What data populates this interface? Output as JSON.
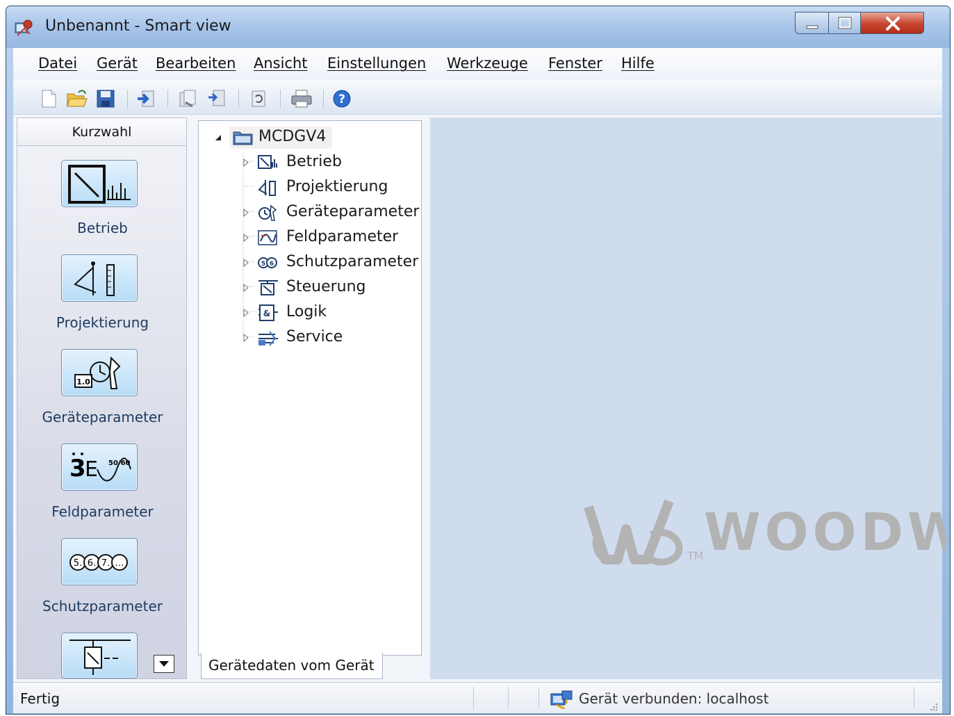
{
  "window": {
    "title": "Unbenannt  - Smart view"
  },
  "menu": {
    "items": [
      "Datei",
      "Gerät",
      "Bearbeiten",
      "Ansicht",
      "Einstellungen",
      "Werkzeuge",
      "Fenster",
      "Hilfe"
    ]
  },
  "toolbar": {
    "icons": [
      "new-document-icon",
      "open-folder-icon",
      "save-icon",
      "transfer-icon",
      "receive-icon",
      "send-icon",
      "refresh-icon",
      "print-icon",
      "help-icon"
    ]
  },
  "quick_access": {
    "header": "Kurzwahl",
    "items": [
      {
        "label": "Betrieb",
        "icon": "operation-meter-icon"
      },
      {
        "label": "Projektierung",
        "icon": "planning-icon"
      },
      {
        "label": "Geräteparameter",
        "icon": "device-parameter-icon"
      },
      {
        "label": "Feldparameter",
        "icon": "field-parameter-icon"
      },
      {
        "label": "Schutzparameter",
        "icon": "protection-parameter-icon"
      },
      {
        "label": "",
        "icon": "control-icon"
      }
    ]
  },
  "tree": {
    "root": "MCDGV4",
    "children": [
      {
        "label": "Betrieb",
        "expandable": true
      },
      {
        "label": "Projektierung",
        "expandable": false
      },
      {
        "label": "Geräteparameter",
        "expandable": true
      },
      {
        "label": "Feldparameter",
        "expandable": true
      },
      {
        "label": "Schutzparameter",
        "expandable": true
      },
      {
        "label": "Steuerung",
        "expandable": true
      },
      {
        "label": "Logik",
        "expandable": true
      },
      {
        "label": "Service",
        "expandable": true
      }
    ],
    "tab_label": "Gerätedaten vom Gerät"
  },
  "content": {
    "logo_text": "WOODW",
    "logo_tm": "TM"
  },
  "status": {
    "text": "Fertig",
    "connection": "Gerät verbunden: localhost"
  },
  "colors": {
    "content_bg": "#cfdcee",
    "accent": "#1e3a5f",
    "logo": "#b3b3b3"
  }
}
